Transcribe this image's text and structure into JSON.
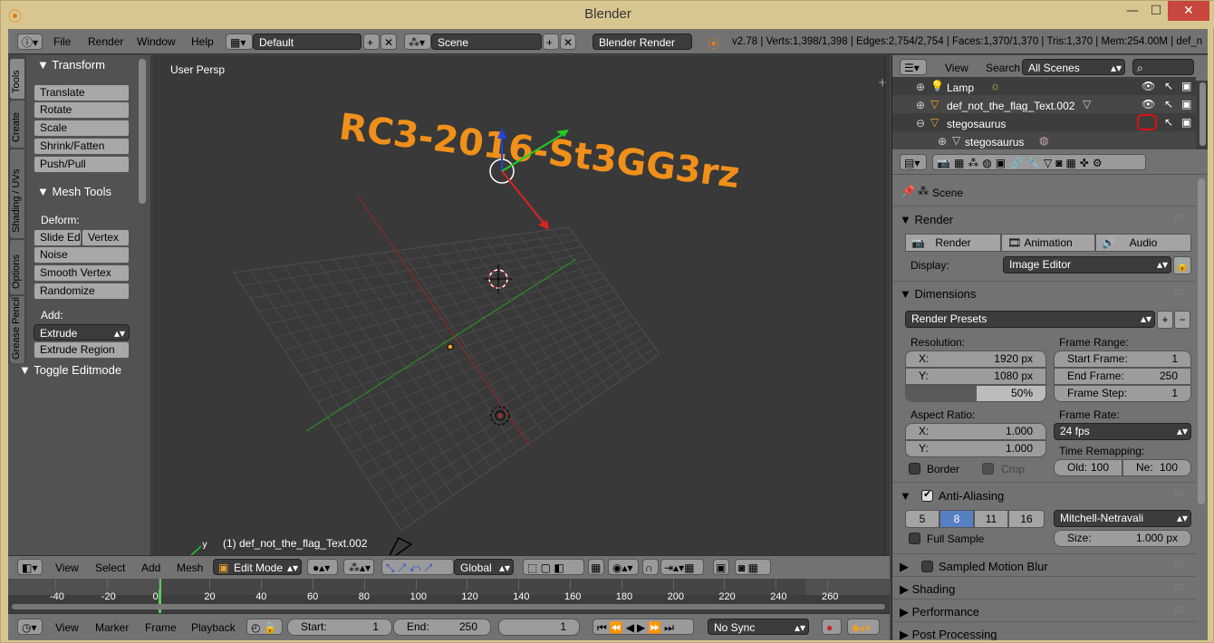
{
  "window": {
    "title": "Blender",
    "min": "—",
    "max": "☐",
    "close": "✕"
  },
  "topbar": {
    "menus": [
      "File",
      "Render",
      "Window",
      "Help"
    ],
    "layout": "Default",
    "scene": "Scene",
    "engine": "Blender Render",
    "stats": "v2.78 | Verts:1,398/1,398 | Edges:2,754/2,754 | Faces:1,370/1,370 | Tris:1,370 | Mem:254.00M | def_n"
  },
  "toolshelf": {
    "tabs": [
      "Tools",
      "Create",
      "Shading / UVs",
      "Options",
      "Grease Pencil"
    ],
    "transform_header": "Transform",
    "transform_buttons": [
      "Translate",
      "Rotate",
      "Scale",
      "Shrink/Fatten",
      "Push/Pull"
    ],
    "mesh_tools_header": "Mesh Tools",
    "deform_label": "Deform:",
    "slide_edge": "Slide Ed",
    "vertex": "Vertex",
    "noise": "Noise",
    "smooth_vertex": "Smooth Vertex",
    "randomize": "Randomize",
    "add_label": "Add:",
    "extrude": "Extrude",
    "extrude_region": "Extrude Region",
    "toggle_editmode": "Toggle Editmode"
  },
  "viewport": {
    "view_label": "User Persp",
    "object_label": "(1) def_not_the_flag_Text.002",
    "flag_text": "RC3-2016-St3GG3rz",
    "colors": {
      "flag": "#f0901a",
      "grid": "#4a4a4a",
      "x_axis": "#9a2a2a",
      "y_axis": "#2a8a2a"
    }
  },
  "viewport_header": {
    "menus": [
      "View",
      "Select",
      "Add",
      "Mesh"
    ],
    "mode": "Edit Mode",
    "orientation": "Global"
  },
  "timeline": {
    "ticks": [
      "-40",
      "-20",
      "0",
      "20",
      "40",
      "60",
      "80",
      "100",
      "120",
      "140",
      "160",
      "180",
      "200",
      "220",
      "240",
      "260"
    ],
    "menus": [
      "View",
      "Marker",
      "Frame",
      "Playback"
    ],
    "start_label": "Start:",
    "start_value": "1",
    "end_label": "End:",
    "end_value": "250",
    "current_frame": "1",
    "sync": "No Sync"
  },
  "outliner": {
    "view": "View",
    "search": "Search",
    "filter": "All Scenes",
    "items": [
      "Lamp",
      "def_not_the_flag_Text.002",
      "stegosaurus",
      "stegosaurus"
    ]
  },
  "properties": {
    "scene": "Scene",
    "render_header": "Render",
    "render_btn": "Render",
    "animation_btn": "Animation",
    "audio_btn": "Audio",
    "display_label": "Display:",
    "display_value": "Image Editor",
    "dimensions_header": "Dimensions",
    "render_presets": "Render Presets",
    "resolution_label": "Resolution:",
    "res_x_label": "X:",
    "res_x": "1920 px",
    "res_y_label": "Y:",
    "res_y": "1080 px",
    "res_pct": "50%",
    "frame_range_label": "Frame Range:",
    "start_frame_label": "Start Frame:",
    "start_frame": "1",
    "end_frame_label": "End Frame:",
    "end_frame": "250",
    "frame_step_label": "Frame Step:",
    "frame_step": "1",
    "aspect_label": "Aspect Ratio:",
    "asp_x_label": "X:",
    "asp_x": "1.000",
    "asp_y_label": "Y:",
    "asp_y": "1.000",
    "frame_rate_label": "Frame Rate:",
    "frame_rate": "24 fps",
    "time_remap_label": "Time Remapping:",
    "old_label": "Old:",
    "old_value": "100",
    "new_label": "Ne:",
    "new_value": "100",
    "border": "Border",
    "crop": "Crop",
    "aa_header": "Anti-Aliasing",
    "aa_samples": [
      "5",
      "8",
      "11",
      "16"
    ],
    "aa_filter": "Mitchell-Netravali",
    "full_sample": "Full Sample",
    "size_label": "Size:",
    "size_value": "1.000 px",
    "motion_blur": "Sampled Motion Blur",
    "shading": "Shading",
    "performance": "Performance",
    "post_processing": "Post Processing"
  }
}
